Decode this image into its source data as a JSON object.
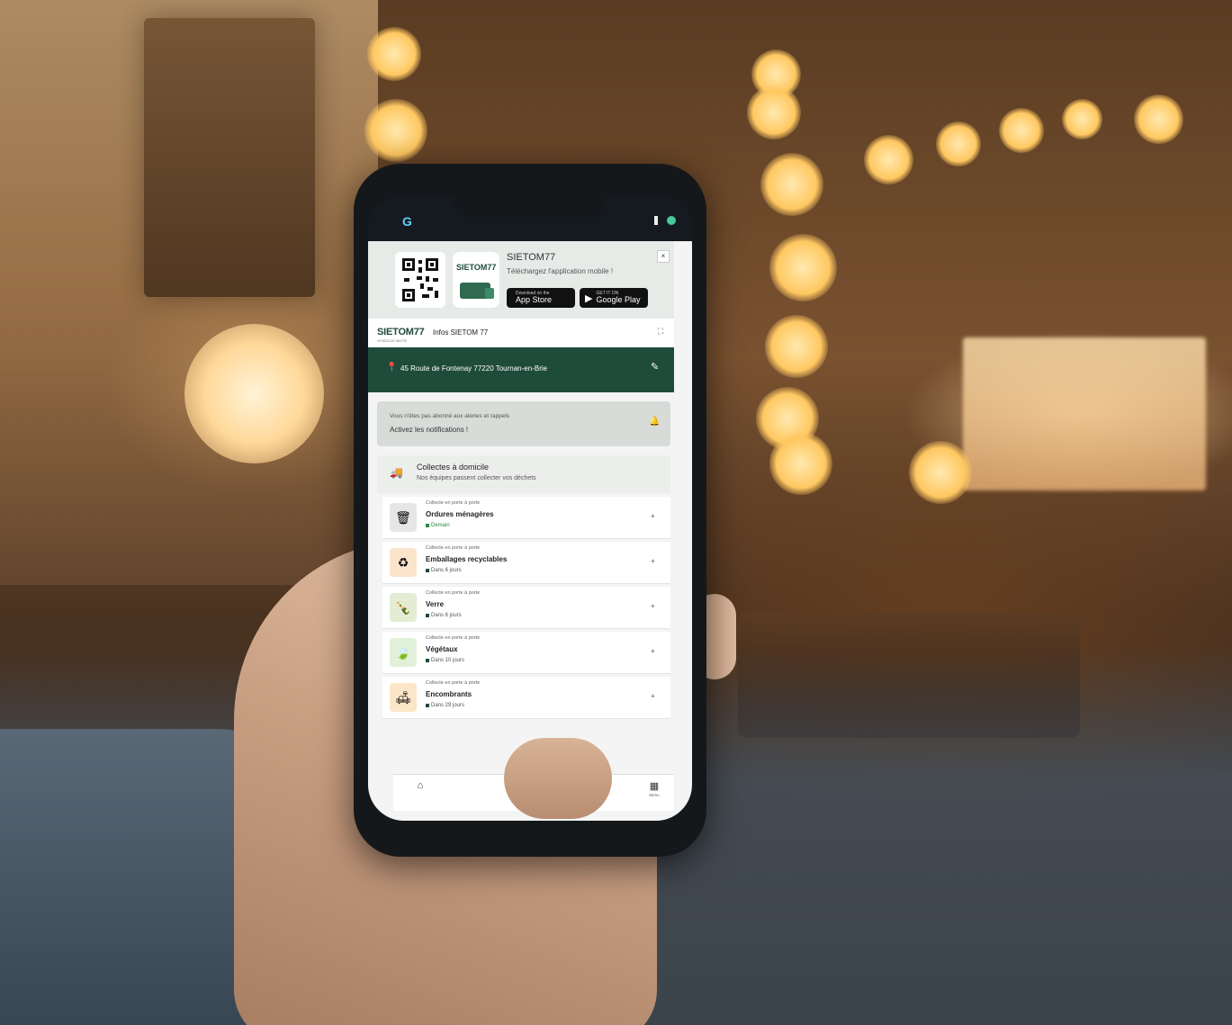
{
  "statusbar": {
    "left_glyph": "G"
  },
  "banner": {
    "app_name": "SIETOM77",
    "subtitle": "Téléchargez l'application mobile !",
    "appstore_small": "Download on the",
    "appstore_big": "App Store",
    "gplay_small": "GET IT ON",
    "gplay_big": "Google Play",
    "close": "×"
  },
  "header": {
    "brand": "SIETOM77",
    "brand_sub": "SYNDICAT MIXTE",
    "title": "Infos SIETOM 77"
  },
  "address": {
    "text": "45 Route de Fontenay 77220 Tournan-en-Brie"
  },
  "notification": {
    "line1": "Vous n'êtes pas abonné aux alertes et rappels",
    "line2": "Activez les notifications !"
  },
  "section": {
    "title": "Collectes à domicile",
    "subtitle": "Nos équipes passent collecter vos déchets"
  },
  "collections": [
    {
      "kicker": "Collecte en porte à porte",
      "title": "Ordures ménagères",
      "when": "Demain",
      "icon": "trash-icon",
      "glyph": "🗑",
      "bg": "#e6e6e6",
      "today": true
    },
    {
      "kicker": "Collecte en porte à porte",
      "title": "Emballages recyclables",
      "when": "Dans 6 jours",
      "icon": "recycle-icon",
      "glyph": "♻",
      "bg": "#fbe4cc",
      "today": false
    },
    {
      "kicker": "Collecte en porte à porte",
      "title": "Verre",
      "when": "Dans 6 jours",
      "icon": "bottle-icon",
      "glyph": "🍾",
      "bg": "#e4ecd4",
      "today": false
    },
    {
      "kicker": "Collecte en porte à porte",
      "title": "Végétaux",
      "when": "Dans 10 jours",
      "icon": "leaf-icon",
      "glyph": "🍃",
      "bg": "#e1f0d8",
      "today": false
    },
    {
      "kicker": "Collecte en porte à porte",
      "title": "Encombrants",
      "when": "Dans 29 jours",
      "icon": "couch-icon",
      "glyph": "🛋",
      "bg": "#fbe6c8",
      "today": false
    }
  ],
  "add_label": "+",
  "tabs": [
    {
      "label": "",
      "icon": "home-icon",
      "glyph": "⌂"
    },
    {
      "label": "",
      "icon": "calendar-icon",
      "glyph": "▦"
    },
    {
      "label": "",
      "icon": "user-icon",
      "glyph": "●"
    },
    {
      "label": "Menu",
      "icon": "menu-grid-icon",
      "glyph": "▦"
    }
  ],
  "colors": {
    "brand_green": "#1f4b3a",
    "status_green": "#2b8a3e"
  }
}
